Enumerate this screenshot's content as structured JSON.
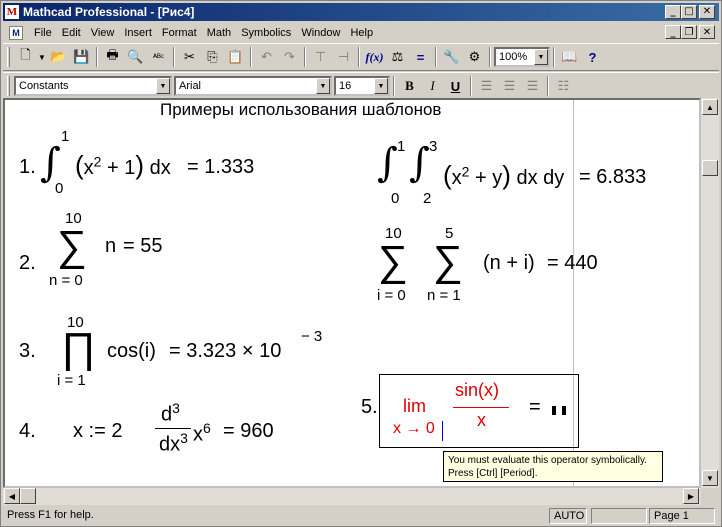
{
  "window": {
    "title": "Mathcad Professional - [Рис4]"
  },
  "menu": [
    "File",
    "Edit",
    "View",
    "Insert",
    "Format",
    "Math",
    "Symbolics",
    "Window",
    "Help"
  ],
  "toolbar2": {
    "style": "Constants",
    "font": "Arial",
    "size": "16"
  },
  "toolbar1": {
    "zoom": "100%"
  },
  "sheet": {
    "heading": "Примеры использования шаблонов",
    "ex1_label": "1.",
    "ex1_result": "= 1.333",
    "ex1b_result": "= 6.833",
    "ex2_label": "2.",
    "ex2_result": "= 55",
    "ex2b_result": "= 440",
    "ex3_label": "3.",
    "ex3_result": "= 3.323 × 10",
    "ex3_exp": "− 3",
    "ex4_label": "4.",
    "ex4_assign": "x := 2",
    "ex4_result": "= 960",
    "ex5_label": "5.",
    "ex5_lim": "lim",
    "ex5_sub": "x → 0",
    "ex5_num": "sin(x)",
    "ex5_den": "x",
    "ex5_eq": "="
  },
  "tooltip": {
    "line1": "You must evaluate this operator symbolically.",
    "line2": "Press [Ctrl] [Period]."
  },
  "status": {
    "help": "Press F1 for help.",
    "mode": "AUTO",
    "page": "Page 1"
  }
}
